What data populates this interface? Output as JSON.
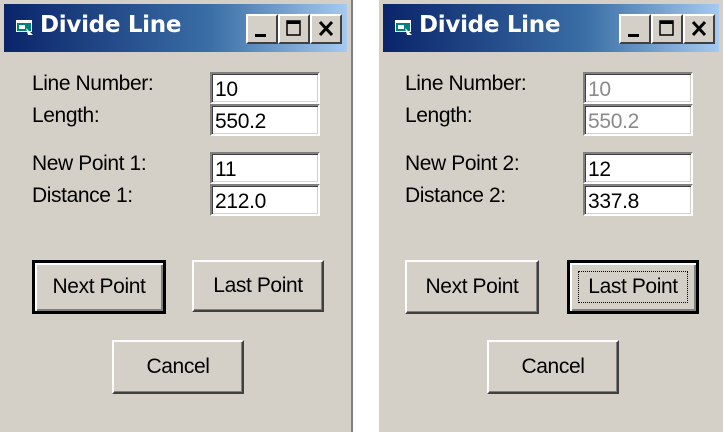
{
  "left_window": {
    "title": "Divide Line",
    "labels": {
      "line_number": "Line Number:",
      "length": "Length:",
      "new_point": "New Point 1:",
      "distance": "Distance 1:"
    },
    "fields": {
      "line_number": "10",
      "length": "550.2",
      "new_point": "11",
      "distance": "212.0"
    },
    "buttons": {
      "next_point": "Next Point",
      "last_point": "Last Point",
      "cancel": "Cancel"
    },
    "default_button": "next_point"
  },
  "right_window": {
    "title": "Divide Line",
    "labels": {
      "line_number": "Line Number:",
      "length": "Length:",
      "new_point": "New Point 2:",
      "distance": "Distance 2:"
    },
    "fields": {
      "line_number": "10",
      "length": "550.2",
      "new_point": "12",
      "distance": "337.8"
    },
    "disabled_fields": [
      "line_number",
      "length"
    ],
    "buttons": {
      "next_point": "Next Point",
      "last_point": "Last Point",
      "cancel": "Cancel"
    },
    "default_button": "last_point"
  },
  "title_bar_buttons": [
    "minimize-icon",
    "maximize-icon",
    "close-icon"
  ],
  "colors": {
    "titlebar_start": "#0a246a",
    "titlebar_end": "#a6caf0",
    "face": "#d4d0c8",
    "disabled_text": "#8a8a8a"
  }
}
